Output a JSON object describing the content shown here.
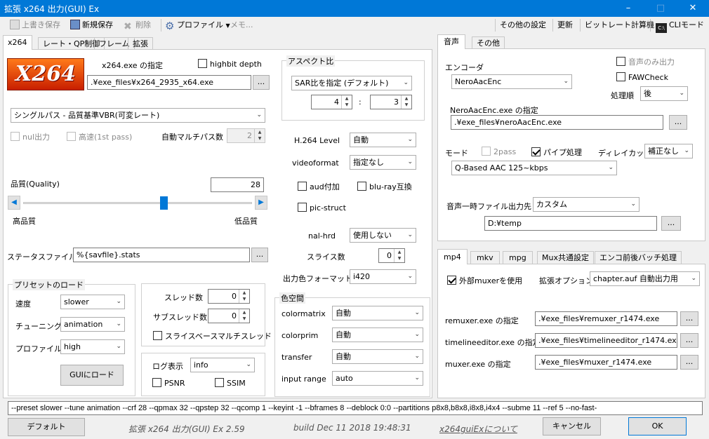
{
  "window": {
    "title": "拡張 x264 出力(GUI) Ex"
  },
  "toolbar": {
    "overwrite": "上書き保存",
    "new_save": "新規保存",
    "delete": "削除",
    "profile": "プロファイル",
    "memo": "メモ...",
    "other_settings": "その他の設定",
    "update": "更新",
    "bitrate_calc": "ビットレート計算機",
    "cli_mode": "CLIモード"
  },
  "left_tabs": [
    "x264",
    "レート・QP制御",
    "フレーム",
    "拡張"
  ],
  "x264": {
    "logo": "X264",
    "exe_label": "x264.exe の指定",
    "highbit": "highbit depth",
    "exe_path": ".¥exe_files¥x264_2935_x64.exe",
    "browse": "...",
    "mode": "シングルパス - 品質基準VBR(可変レート)",
    "nul_output": "nul出力",
    "fast_1st": "高速(1st pass)",
    "auto_multipass": "自動マルチパス数",
    "auto_multipass_val": "2",
    "quality_label": "品質(Quality)",
    "quality_val": "28",
    "quality_slider": 0.62,
    "high_q": "高品質",
    "low_q": "低品質",
    "status_label": "ステータスファイル",
    "status_val": "%{savfile}.stats",
    "preset_group": "プリセットのロード",
    "speed_label": "速度",
    "speed_val": "slower",
    "tune_label": "チューニング",
    "tune_val": "animation",
    "profile_label": "プロファイル",
    "profile_val": "high",
    "gui_load": "GUIにロード",
    "threads_label": "スレッド数",
    "threads_val": "0",
    "subthreads_label": "サブスレッド数",
    "subthreads_val": "0",
    "slice_mt": "スライスベースマルチスレッド",
    "log_label": "ログ表示",
    "log_val": "info",
    "psnr": "PSNR",
    "ssim": "SSIM"
  },
  "aspect": {
    "title": "アスペクト比",
    "mode": "SAR比を指定 (デフォルト)",
    "w": "4",
    "h": "3",
    "sep": ":"
  },
  "h264": {
    "level_label": "H.264 Level",
    "level_val": "自動",
    "videoformat_label": "videoformat",
    "videoformat_val": "指定なし",
    "aud": "aud付加",
    "bluray": "blu-ray互換",
    "pic_struct": "pic-struct",
    "nalhrd_label": "nal-hrd",
    "nalhrd_val": "使用しない",
    "slices_label": "スライス数",
    "slices_val": "0",
    "csp_label": "出力色フォーマット",
    "csp_val": "i420"
  },
  "colorspace": {
    "title": "色空間",
    "matrix_label": "colormatrix",
    "matrix_val": "自動",
    "prim_label": "colorprim",
    "prim_val": "自動",
    "transfer_label": "transfer",
    "transfer_val": "自動",
    "range_label": "input range",
    "range_val": "auto"
  },
  "audio_tabs": [
    "音声",
    "その他"
  ],
  "audio": {
    "encoder_label": "エンコーダ",
    "encoder_val": "NeroAacEnc",
    "audio_only": "音声のみ出力",
    "faw": "FAWCheck",
    "order_label": "処理順",
    "order_val": "後",
    "exe_label": "NeroAacEnc.exe の指定",
    "exe_path": ".¥exe_files¥neroAacEnc.exe",
    "mode_label": "モード",
    "twopass": "2pass",
    "pipe": "パイプ処理",
    "delay_label": "ディレイカット",
    "delay_val": "補正なし",
    "mode_val": "Q-Based AAC 125~kbps",
    "temp_label": "音声一時ファイル出力先",
    "temp_val": "カスタム",
    "temp_path": "D:¥temp"
  },
  "mux_tabs": [
    "mp4",
    "mkv",
    "mpg",
    "Mux共通設定",
    "エンコ前後バッチ処理"
  ],
  "mux": {
    "use_external": "外部muxerを使用",
    "ext_opt_label": "拡張オプション",
    "ext_opt_val": "chapter.auf 自動出力用",
    "remuxer_label": "remuxer.exe の指定",
    "remuxer_path": ".¥exe_files¥remuxer_r1474.exe",
    "timeline_label": "timelineeditor.exe の指定",
    "timeline_path": ".¥exe_files¥timelineeditor_r1474.exe",
    "muxer_label": "muxer.exe の指定",
    "muxer_path": ".¥exe_files¥muxer_r1474.exe"
  },
  "cmdline": "--preset slower --tune animation --crf 28 --qpmax 32 --qpstep 32 --qcomp 1 --keyint -1 --bframes 8 --deblock 0:0 --partitions p8x8,b8x8,i8x8,i4x4 --subme 11 --ref 5 --no-fast-",
  "footer": {
    "default": "デフォルト",
    "version": "拡張 x264 出力(GUI) Ex 2.59",
    "build": "build Dec 11 2018 19:48:31",
    "about": "x264guiExについて",
    "cancel": "キャンセル",
    "ok": "OK"
  },
  "colors": {
    "titlebar": "#0078d7",
    "slider_thumb": "#0078d7"
  }
}
